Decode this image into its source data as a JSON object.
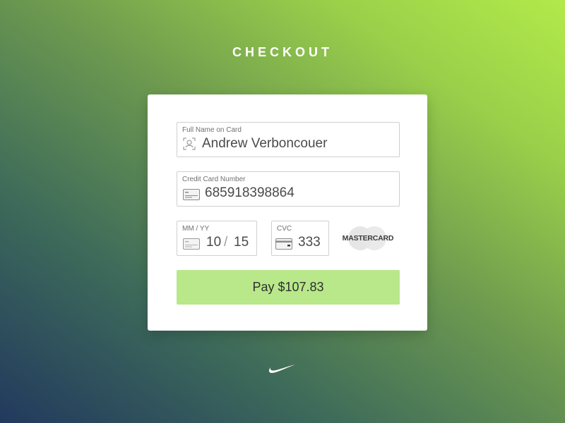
{
  "page": {
    "title": "CHECKOUT"
  },
  "form": {
    "name": {
      "label": "Full Name on Card",
      "value": "Andrew Verboncouer",
      "icon": "person-scan-icon"
    },
    "card_number": {
      "label": "Credit Card Number",
      "value": "685918398864",
      "icon": "credit-card-icon"
    },
    "expiry": {
      "label": "MM / YY",
      "month": "10",
      "separator": "/",
      "year": "15",
      "icon": "card-outline-icon"
    },
    "cvc": {
      "label": "CVC",
      "value": "333",
      "icon": "card-back-icon"
    },
    "card_brand": "MASTERCARD",
    "pay_label": "Pay $107.83"
  },
  "footer": {
    "logo_icon": "swoosh-icon"
  },
  "colors": {
    "pay_button": "#b8e88a",
    "gradient_start": "#22395e",
    "gradient_end": "#b2ea4a"
  }
}
